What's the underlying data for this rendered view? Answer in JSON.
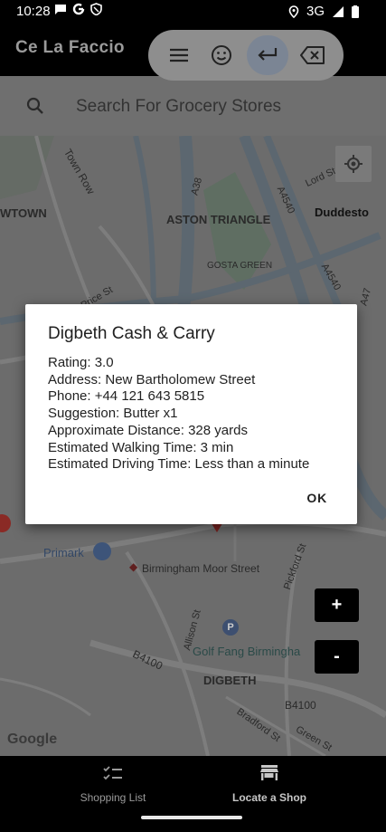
{
  "status_bar": {
    "time": "10:28",
    "network": "3G"
  },
  "app_bar": {
    "title": "Ce La Faccio"
  },
  "search": {
    "placeholder": "Search For Grocery Stores"
  },
  "map": {
    "labels": {
      "town_row": "Town Row",
      "twtown": "WTOWN",
      "aston_triangle": "ASTON TRIANGLE",
      "duddeston": "Duddesto",
      "gosta_green": "GOSTA GREEN",
      "price_st": "Price St",
      "lord_st": "Lord St",
      "a38": "A38",
      "a4540": "A4540",
      "a4540b": "A4540",
      "a47": "A47",
      "primark": "Primark",
      "moor_street": "Birmingham Moor Street",
      "digbeth": "DIGBETH",
      "golf_fang": "Golf Fang Birmingha",
      "b4100": "B4100",
      "b4100b": "B4100",
      "allison_st": "Allison St",
      "pickford_st": "Pickford St",
      "bradford_st": "Bradford St",
      "green_st": "Green St",
      "google": "Google"
    }
  },
  "zoom": {
    "in_label": "+",
    "out_label": "-"
  },
  "dialog": {
    "title": "Digbeth Cash & Carry",
    "lines": [
      "Rating: 3.0",
      "Address: New Bartholomew Street",
      "Phone: +44 121 643 5815",
      "Suggestion: Butter x1",
      "Approximate Distance: 328 yards",
      "Estimated Walking Time: 3 min",
      "Estimated Driving Time: Less than a minute"
    ],
    "ok_label": "OK"
  },
  "bottom_nav": {
    "items": [
      {
        "label": "Shopping List",
        "icon": "checklist-icon",
        "active": false
      },
      {
        "label": "Locate a Shop",
        "icon": "store-icon",
        "active": true
      }
    ]
  },
  "colors": {
    "background": "#000000",
    "dialog": "#ffffff",
    "map_dim": "#6c6c6c",
    "toolbar": "#8e8e8e"
  }
}
